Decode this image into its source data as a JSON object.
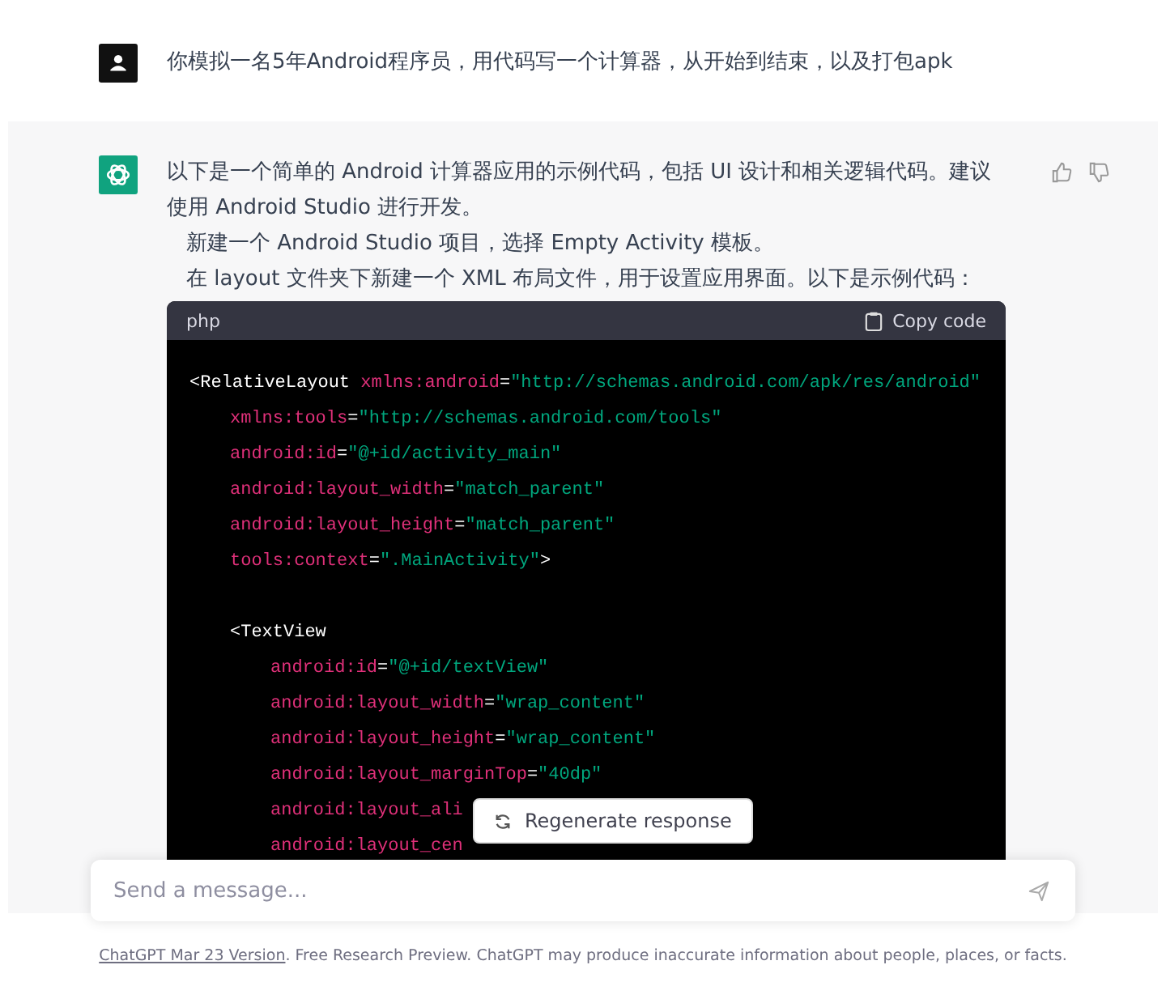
{
  "user_message": {
    "text": "你模拟一名5年Android程序员，用代码写一个计算器，从开始到结束，以及打包apk"
  },
  "assistant_message": {
    "paragraphs": [
      {
        "text": "以下是一个简单的 Android 计算器应用的示例代码，包括 UI 设计和相关逻辑代码。建议使用 Android Studio 进行开发。",
        "kind": "plain"
      },
      {
        "text": "新建一个 Android Studio 项目，选择 Empty Activity 模板。",
        "kind": "step"
      },
      {
        "text": "在 layout 文件夹下新建一个 XML 布局文件，用于设置应用界面。以下是示例代码：",
        "kind": "step"
      }
    ],
    "code_block": {
      "language": "php",
      "copy_label": "Copy code",
      "lines": [
        {
          "kind": "code",
          "tokens": [
            {
              "kind": "tag",
              "text": "<RelativeLayout "
            },
            {
              "kind": "attr",
              "text": "xmlns:android"
            },
            {
              "kind": "punct",
              "text": "="
            },
            {
              "kind": "value",
              "text": "\"http://schemas.android.com/apk/res/android\""
            }
          ],
          "children": [
            {
              "kind": "code",
              "tokens": [
                {
                  "kind": "attr",
                  "text": "xmlns:tools"
                },
                {
                  "kind": "punct",
                  "text": "="
                },
                {
                  "kind": "value",
                  "text": "\"http://schemas.android.com/tools\""
                }
              ]
            },
            {
              "kind": "code",
              "tokens": [
                {
                  "kind": "attr",
                  "text": "android:id"
                },
                {
                  "kind": "punct",
                  "text": "="
                },
                {
                  "kind": "value",
                  "text": "\"@+id/activity_main\""
                }
              ]
            },
            {
              "kind": "code",
              "tokens": [
                {
                  "kind": "attr",
                  "text": "android:layout_width"
                },
                {
                  "kind": "punct",
                  "text": "="
                },
                {
                  "kind": "value",
                  "text": "\"match_parent\""
                }
              ]
            },
            {
              "kind": "code",
              "tokens": [
                {
                  "kind": "attr",
                  "text": "android:layout_height"
                },
                {
                  "kind": "punct",
                  "text": "="
                },
                {
                  "kind": "value",
                  "text": "\"match_parent\""
                }
              ]
            },
            {
              "kind": "code",
              "tokens": [
                {
                  "kind": "attr",
                  "text": "tools:context"
                },
                {
                  "kind": "punct",
                  "text": "="
                },
                {
                  "kind": "value",
                  "text": "\".MainActivity\""
                },
                {
                  "kind": "tag",
                  "text": ">"
                }
              ]
            },
            {
              "kind": "blank"
            },
            {
              "kind": "code",
              "tokens": [
                {
                  "kind": "tag",
                  "text": "<TextView"
                }
              ],
              "children": [
                {
                  "kind": "code",
                  "tokens": [
                    {
                      "kind": "attr",
                      "text": "android:id"
                    },
                    {
                      "kind": "punct",
                      "text": "="
                    },
                    {
                      "kind": "value",
                      "text": "\"@+id/textView\""
                    }
                  ]
                },
                {
                  "kind": "code",
                  "tokens": [
                    {
                      "kind": "attr",
                      "text": "android:layout_width"
                    },
                    {
                      "kind": "punct",
                      "text": "="
                    },
                    {
                      "kind": "value",
                      "text": "\"wrap_content\""
                    }
                  ]
                },
                {
                  "kind": "code",
                  "tokens": [
                    {
                      "kind": "attr",
                      "text": "android:layout_height"
                    },
                    {
                      "kind": "punct",
                      "text": "="
                    },
                    {
                      "kind": "value",
                      "text": "\"wrap_content\""
                    }
                  ]
                },
                {
                  "kind": "code",
                  "tokens": [
                    {
                      "kind": "attr",
                      "text": "android:layout_marginTop"
                    },
                    {
                      "kind": "punct",
                      "text": "="
                    },
                    {
                      "kind": "value",
                      "text": "\"40dp\""
                    }
                  ]
                },
                {
                  "kind": "code",
                  "tokens": [
                    {
                      "kind": "attr",
                      "text": "android:layout_ali"
                    }
                  ]
                },
                {
                  "kind": "code",
                  "tokens": [
                    {
                      "kind": "attr",
                      "text": "android:layout_cen"
                    }
                  ]
                }
              ]
            }
          ]
        }
      ]
    }
  },
  "regenerate_button": {
    "label": "Regenerate response"
  },
  "composer": {
    "placeholder": "Send a message..."
  },
  "footer": {
    "link": "ChatGPT Mar 23 Version",
    "text": ". Free Research Preview. ChatGPT may produce inaccurate information about people, places, or facts."
  }
}
